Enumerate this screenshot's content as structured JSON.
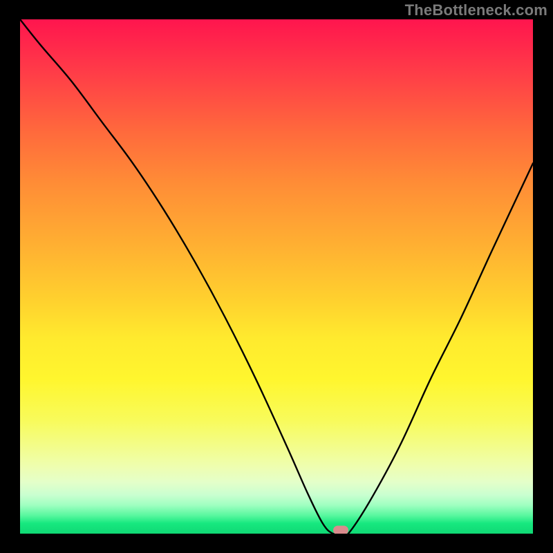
{
  "watermark": "TheBottleneck.com",
  "chart_data": {
    "type": "line",
    "title": "",
    "xlabel": "",
    "ylabel": "",
    "ylim": [
      0,
      100
    ],
    "xlim": [
      0,
      100
    ],
    "x": [
      0,
      4,
      10,
      16,
      22,
      28,
      34,
      40,
      46,
      52,
      56,
      59,
      61,
      63,
      64,
      68,
      74,
      80,
      86,
      92,
      100
    ],
    "values": [
      100,
      95,
      88,
      80,
      72,
      63,
      53,
      42,
      30,
      17,
      8,
      2,
      0,
      0,
      0,
      6,
      17,
      30,
      42,
      55,
      72
    ],
    "marker": {
      "x": 62.5,
      "y": 0
    },
    "background": "heat-gradient-red-to-green"
  },
  "plot": {
    "inner_left": 29,
    "inner_top": 28,
    "inner_width": 742,
    "inner_height": 744
  }
}
